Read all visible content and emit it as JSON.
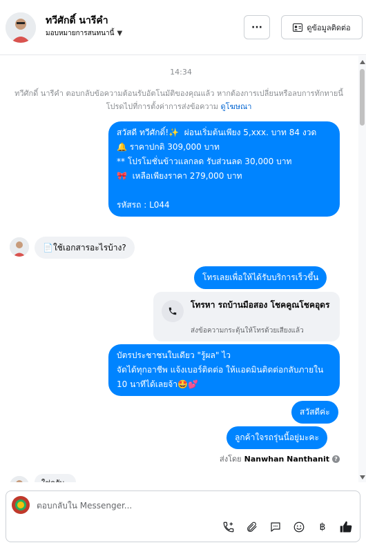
{
  "header": {
    "contact_name": "ทวีศักดิ์ นารีคำ",
    "assign_label": "มอบหมายการสนทนานี้",
    "more_label": "···",
    "contact_info_label": "ดูข้อมูลติดต่อ"
  },
  "conversation": {
    "time": "14:34",
    "system_notice": "ทวีศักดิ์ นารีคำ ตอบกลับข้อความต้อนรับอัตโนมัติของคุณแล้ว หากต้องการเปลี่ยนหรือลบการทักทายนี้ โปรดไปที่การตั้งค่าการส่งข้อความ",
    "system_link": "ดูโฆษณา",
    "messages": [
      {
        "dir": "out",
        "text": "สวัสดี ทวีศักดิ์!✨  ผ่อนเริ่มต้นเพียง 5,xxx. บาท 84 งวด\n🔔 ราคาปกติ 309,000 บาท\n** โปรโมชั่นข้าวแลกลด รับส่วนลด 30,000 บาท\n🎀  เหลือเพียงราคา 279,000 บาท\n\nรหัสรถ : L044"
      },
      {
        "dir": "in",
        "text": "📄ใช้เอกสารอะไรบ้าง?"
      },
      {
        "dir": "out",
        "text": "โทรเลยเพื่อให้ได้รับบริการเร็วขึ้น"
      },
      {
        "dir": "out",
        "text": "บัตรประชาชนใบเดียว \"รู้ผล\" ไว\nจัดได้ทุกอาชีพ แจ้งเบอร์ติดต่อ ให้แอดมินติดต่อกลับภายใน 10 นาทีได้เลยจ้า🤩💕"
      },
      {
        "dir": "out",
        "text": "สวัสดีค่ะ"
      },
      {
        "dir": "out",
        "text": "ลูกค้าใจรถรุ่นนี้อยู่มะคะ"
      }
    ],
    "call_card": {
      "title": "โทรหา รถบ้านมือสอง โชคคูณโชคอุดร",
      "subtitle": "ส่งข้อความกระตุ้นให้โทรด้วยเสียงแล้ว"
    },
    "sent_by_prefix": "ส่งโดย",
    "sent_by_name": "Nanwhan Nanthanit",
    "partial_message": "ใช่ครับ"
  },
  "composer": {
    "placeholder": "ตอบกลับใน Messenger..."
  },
  "icons": [
    "more-icon",
    "contact-card-icon",
    "phone-icon",
    "add-call-icon",
    "attach-icon",
    "saved-reply-icon",
    "emoji-icon",
    "baht-icon",
    "like-icon",
    "help-icon"
  ],
  "colors": {
    "outgoing_bubble": "#0084ff",
    "incoming_bubble": "#f0f2f5",
    "link": "#0064d1"
  }
}
